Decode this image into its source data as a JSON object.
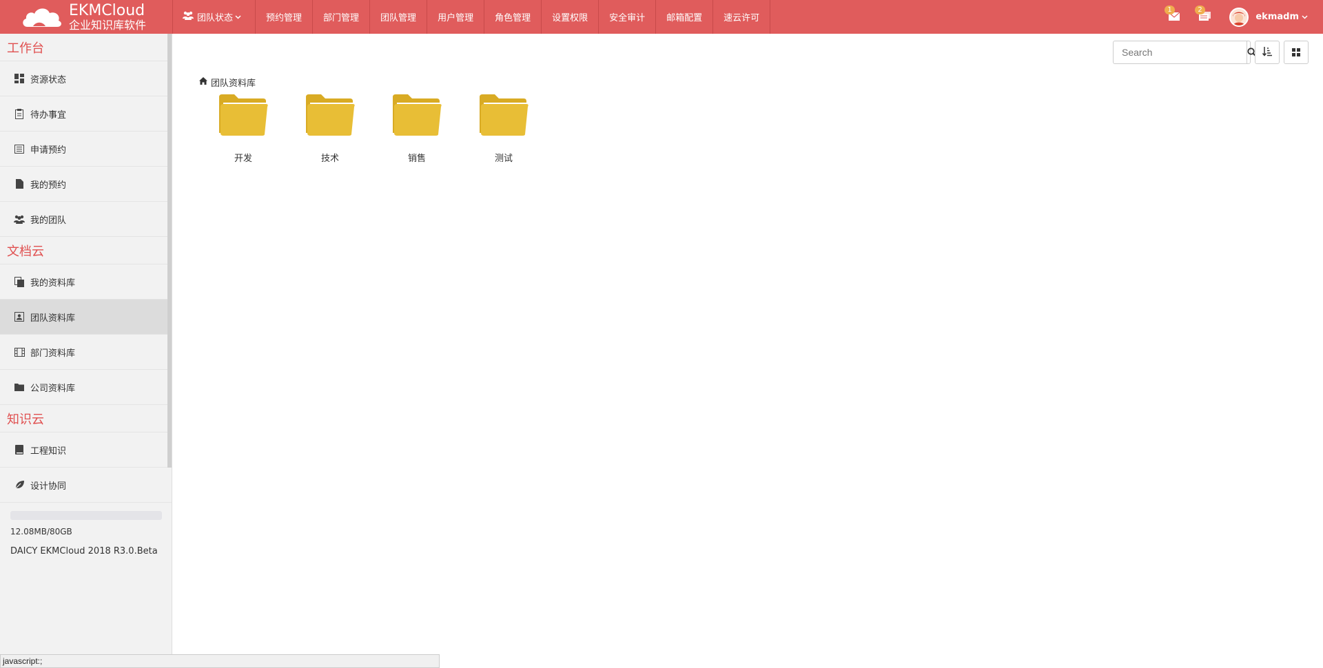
{
  "app": {
    "logo_title": "EKMCloud",
    "logo_subtitle": "企业知识库软件"
  },
  "nav": [
    {
      "label": "团队状态",
      "icon": "users-icon",
      "dropdown": true
    },
    {
      "label": "预约管理"
    },
    {
      "label": "部门管理"
    },
    {
      "label": "团队管理"
    },
    {
      "label": "用户管理"
    },
    {
      "label": "角色管理"
    },
    {
      "label": "设置权限"
    },
    {
      "label": "安全审计"
    },
    {
      "label": "邮箱配置"
    },
    {
      "label": "速云许可"
    }
  ],
  "topright": {
    "mail_badge": "1",
    "tasks_badge": "2",
    "username": "ekmadm"
  },
  "sidebar": {
    "sections": [
      {
        "title": "工作台",
        "items": [
          {
            "label": "资源状态",
            "icon": "dashboard-icon"
          },
          {
            "label": "待办事宜",
            "icon": "clipboard-icon"
          },
          {
            "label": "申请预约",
            "icon": "list-icon"
          },
          {
            "label": "我的预约",
            "icon": "file-icon"
          },
          {
            "label": "我的团队",
            "icon": "users-icon"
          }
        ]
      },
      {
        "title": "文档云",
        "items": [
          {
            "label": "我的资料库",
            "icon": "files-icon"
          },
          {
            "label": "团队资料库",
            "icon": "contact-icon",
            "active": true
          },
          {
            "label": "部门资料库",
            "icon": "film-icon"
          },
          {
            "label": "公司资料库",
            "icon": "folder-icon"
          }
        ]
      },
      {
        "title": "知识云",
        "items": [
          {
            "label": "工程知识",
            "icon": "book-icon"
          },
          {
            "label": "设计协同",
            "icon": "leaf-icon"
          }
        ]
      }
    ],
    "storage_used_fraction": 0.0001,
    "storage_text": "12.08MB/80GB",
    "version": "DAICY EKMCloud 2018 R3.0.Beta"
  },
  "toolbar": {
    "search_placeholder": "Search"
  },
  "breadcrumb": "团队资料库",
  "folders": [
    "开发",
    "技术",
    "销售",
    "测试"
  ],
  "folder_color": "#e8be36",
  "accent_color": "#e05c5c",
  "statusbar": "javascript:;"
}
